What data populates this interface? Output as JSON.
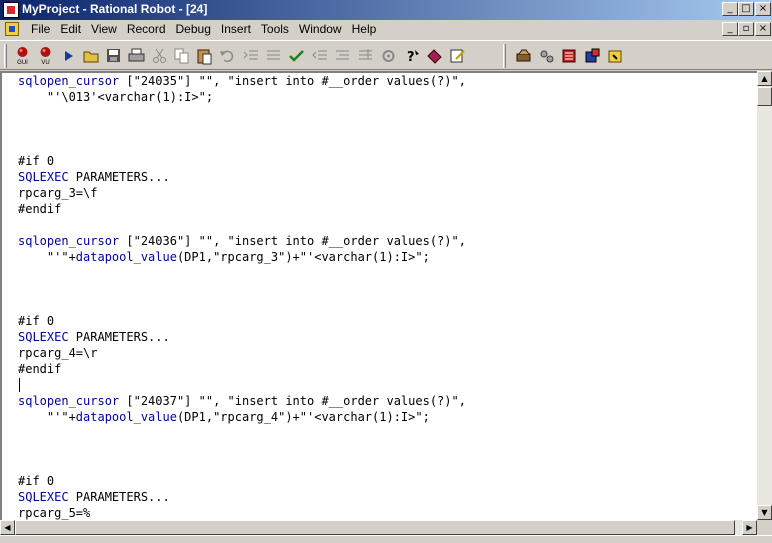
{
  "window": {
    "title": "MyProject - Rational Robot - [24]",
    "minimize_glyph": "_",
    "maximize_glyph": "□",
    "close_glyph": "×",
    "restore_glyph": "▫"
  },
  "menu": {
    "items": [
      "File",
      "Edit",
      "View",
      "Record",
      "Debug",
      "Insert",
      "Tools",
      "Window",
      "Help"
    ]
  },
  "toolbar": {
    "gui_label": "GUI",
    "vu_label": "VU",
    "buttons": [
      {
        "icon": "record-gui-icon"
      },
      {
        "icon": "record-vu-icon"
      },
      {
        "icon": "play-icon"
      },
      {
        "icon": "open-icon"
      },
      {
        "icon": "save-icon"
      },
      {
        "icon": "print-icon"
      },
      {
        "icon": "cut-icon"
      },
      {
        "icon": "copy-icon"
      },
      {
        "icon": "paste-icon"
      },
      {
        "icon": "undo-icon"
      },
      {
        "icon": "indent-icon"
      },
      {
        "icon": "comment-icon"
      },
      {
        "icon": "check-syntax-icon"
      },
      {
        "icon": "outdent-icon"
      },
      {
        "icon": "uncomment-icon"
      },
      {
        "icon": "bookmark-icon"
      },
      {
        "icon": "compile-icon"
      },
      {
        "icon": "help-icon"
      },
      {
        "icon": "book-icon"
      },
      {
        "icon": "edit-icon"
      },
      {
        "icon": "tool1-icon"
      },
      {
        "icon": "tool2-icon"
      },
      {
        "icon": "tool3-icon"
      },
      {
        "icon": "tool4-icon"
      },
      {
        "icon": "tool5-icon"
      }
    ]
  },
  "editor": {
    "lines": [
      [
        {
          "t": "sqlopen_cursor",
          "k": 1
        },
        {
          "t": " [\"24035\"] \"\", \"insert into #__order values(?)\","
        }
      ],
      [
        {
          "t": "    \"'\\013'<varchar(1):I>\";"
        }
      ],
      [
        {
          "t": ""
        }
      ],
      [
        {
          "t": ""
        }
      ],
      [
        {
          "t": ""
        }
      ],
      [
        {
          "t": "#if 0"
        }
      ],
      [
        {
          "t": "SQLEXEC",
          "k": 1
        },
        {
          "t": " PARAMETERS..."
        }
      ],
      [
        {
          "t": "rpcarg_3=\\f"
        }
      ],
      [
        {
          "t": "#endif"
        }
      ],
      [
        {
          "t": ""
        }
      ],
      [
        {
          "t": "sqlopen_cursor",
          "k": 1
        },
        {
          "t": " [\"24036\"] \"\", \"insert into #__order values(?)\","
        }
      ],
      [
        {
          "t": "    \"'\"+"
        },
        {
          "t": "datapool_value",
          "k": 1
        },
        {
          "t": "(DP1,\"rpcarg_3\")+\"'<varchar(1):I>\";"
        }
      ],
      [
        {
          "t": ""
        }
      ],
      [
        {
          "t": ""
        }
      ],
      [
        {
          "t": ""
        }
      ],
      [
        {
          "t": "#if 0"
        }
      ],
      [
        {
          "t": "SQLEXEC",
          "k": 1
        },
        {
          "t": " PARAMETERS..."
        }
      ],
      [
        {
          "t": "rpcarg_4=\\r"
        }
      ],
      [
        {
          "t": "#endif"
        }
      ],
      [
        {
          "t": ""
        }
      ],
      [
        {
          "t": "sqlopen_cursor",
          "k": 1
        },
        {
          "t": " [\"24037\"] \"\", \"insert into #__order values(?)\","
        }
      ],
      [
        {
          "t": "    \"'\"+"
        },
        {
          "t": "datapool_value",
          "k": 1
        },
        {
          "t": "(DP1,\"rpcarg_4\")+\"'<varchar(1):I>\";"
        }
      ],
      [
        {
          "t": ""
        }
      ],
      [
        {
          "t": ""
        }
      ],
      [
        {
          "t": ""
        }
      ],
      [
        {
          "t": "#if 0"
        }
      ],
      [
        {
          "t": "SQLEXEC",
          "k": 1
        },
        {
          "t": " PARAMETERS..."
        }
      ],
      [
        {
          "t": "rpcarg_5=%"
        }
      ]
    ]
  },
  "scrollbar": {
    "up_glyph": "▲",
    "down_glyph": "▼",
    "left_glyph": "◀",
    "right_glyph": "▶"
  },
  "colors": {
    "keyword": "#0000a0",
    "titlebar_start": "#0a246a",
    "titlebar_end": "#a6caf0"
  }
}
